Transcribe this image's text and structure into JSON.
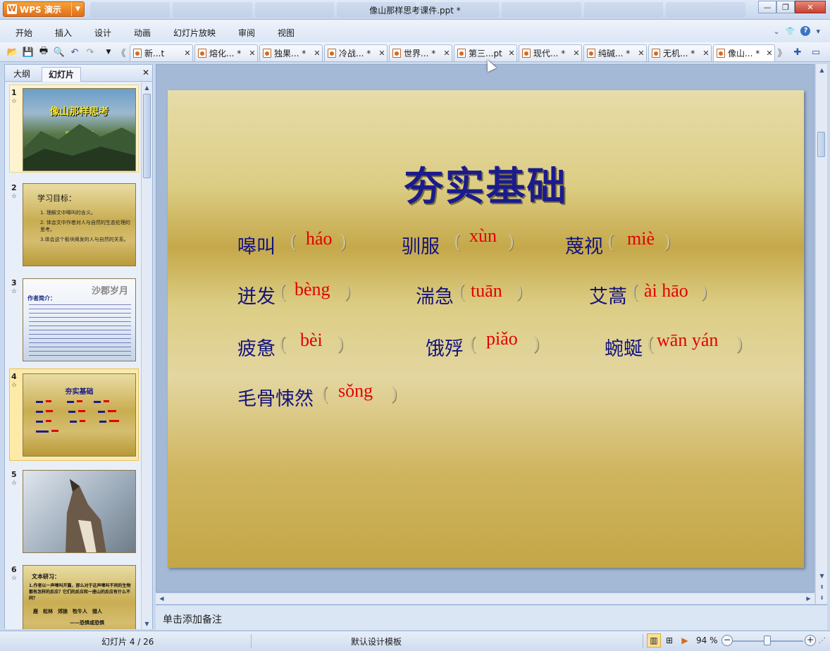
{
  "app": {
    "name": "WPS 演示",
    "window_title": "像山那样思考课件.ppt *"
  },
  "menu": [
    "开始",
    "插入",
    "设计",
    "动画",
    "幻灯片放映",
    "审阅",
    "视图"
  ],
  "doc_tabs": [
    {
      "label": "新...t"
    },
    {
      "label": "熔化... *"
    },
    {
      "label": "独果... *"
    },
    {
      "label": "冷战... *"
    },
    {
      "label": "世界... *"
    },
    {
      "label": "第三...pt"
    },
    {
      "label": "现代... *"
    },
    {
      "label": "纯碱... *"
    },
    {
      "label": "无机... *"
    },
    {
      "label": "像山... *"
    }
  ],
  "left_panel": {
    "tabs": [
      "大纲",
      "幻灯片"
    ],
    "active_tab": "幻灯片",
    "slides": [
      {
        "num": "1",
        "title": "像山那样思考",
        "subtitle": "高中 人教 选修"
      },
      {
        "num": "2",
        "heading": "学习目标：",
        "lines": [
          "1. 理解文中嗥叫的含义。",
          "2. 体会文中作者对人与自然的生态伦理的思考。",
          "3.体会这个板块阐发的人与自然的关系。"
        ]
      },
      {
        "num": "3",
        "title": "沙郡岁月",
        "heading": "作者简介："
      },
      {
        "num": "4",
        "title": "夯实基础"
      },
      {
        "num": "5"
      },
      {
        "num": "6",
        "heading": "文本研习：",
        "lines": [
          "1.作者以一声嗥叫开篇，那么对于这声嗥叫不同的生物都有怎样的反应？它们的反应和一座山的反应有什么不同？",
          "鹿　松林　郊狼　牧牛人　猎人",
          "——恐惧或恐惧"
        ]
      }
    ]
  },
  "slide": {
    "title": "夯实基础",
    "items": [
      {
        "word": "嗥叫",
        "pinyin": "háo"
      },
      {
        "word": "驯服",
        "pinyin": "xùn"
      },
      {
        "word": "蔑视",
        "pinyin": "miè"
      },
      {
        "word": "迸发",
        "pinyin": "bèng"
      },
      {
        "word": "湍急",
        "pinyin": "tuān"
      },
      {
        "word": "艾蒿",
        "pinyin": "ài hāo"
      },
      {
        "word": "疲惫",
        "pinyin": "bèi"
      },
      {
        "word": "饿殍",
        "pinyin": "piǎo"
      },
      {
        "word": "蜿蜒",
        "pinyin": "wān yán"
      },
      {
        "word": "毛骨悚然",
        "pinyin": "sǒng"
      }
    ],
    "open_paren": "(",
    "close_paren": ")"
  },
  "notes_placeholder": "单击添加备注",
  "status": {
    "slide_counter": "幻灯片 4 / 26",
    "template": "默认设计模板",
    "zoom": "94 %"
  },
  "colors": {
    "slide_title": "#1b1b8c",
    "word": "#13137e",
    "pinyin": "#e30000",
    "wps_orange": "#f08a28"
  }
}
